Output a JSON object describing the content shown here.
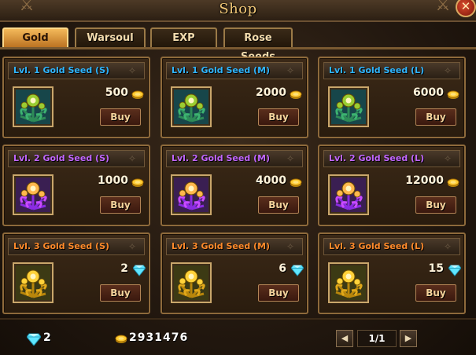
{
  "window": {
    "title": "Shop"
  },
  "tabs": [
    {
      "label": "Gold",
      "active": true
    },
    {
      "label": "Warsoul",
      "active": false
    },
    {
      "label": "EXP",
      "active": false
    },
    {
      "label": "Rose Seeds",
      "active": false
    }
  ],
  "items": [
    {
      "name": "Lvl. 1 Gold Seed (S)",
      "price": "500",
      "currency": "gold",
      "buy_label": "Buy",
      "rarity": "blue"
    },
    {
      "name": "Lvl. 1 Gold Seed (M)",
      "price": "2000",
      "currency": "gold",
      "buy_label": "Buy",
      "rarity": "blue"
    },
    {
      "name": "Lvl. 1 Gold Seed (L)",
      "price": "6000",
      "currency": "gold",
      "buy_label": "Buy",
      "rarity": "blue"
    },
    {
      "name": "Lvl. 2 Gold Seed (S)",
      "price": "1000",
      "currency": "gold",
      "buy_label": "Buy",
      "rarity": "purple"
    },
    {
      "name": "Lvl. 2 Gold Seed (M)",
      "price": "4000",
      "currency": "gold",
      "buy_label": "Buy",
      "rarity": "purple"
    },
    {
      "name": "Lvl. 2 Gold Seed (L)",
      "price": "12000",
      "currency": "gold",
      "buy_label": "Buy",
      "rarity": "purple"
    },
    {
      "name": "Lvl. 3 Gold Seed (S)",
      "price": "2",
      "currency": "diamond",
      "buy_label": "Buy",
      "rarity": "orange"
    },
    {
      "name": "Lvl. 3 Gold Seed (M)",
      "price": "6",
      "currency": "diamond",
      "buy_label": "Buy",
      "rarity": "orange"
    },
    {
      "name": "Lvl. 3 Gold Seed (L)",
      "price": "15",
      "currency": "diamond",
      "buy_label": "Buy",
      "rarity": "orange"
    }
  ],
  "footer": {
    "diamond_balance": "2",
    "gold_balance": "2931476",
    "page": "1/1"
  },
  "icons": {
    "close": "close-icon",
    "coin": "gold-coin-icon",
    "gem": "diamond-icon",
    "prev": "page-prev-icon",
    "next": "page-next-icon"
  },
  "colors": {
    "tier1": "#2fb5ff",
    "tier2": "#c166ff",
    "tier3": "#ff8a2a",
    "title": "#f2c877",
    "active_tab": "#f3b95a"
  }
}
